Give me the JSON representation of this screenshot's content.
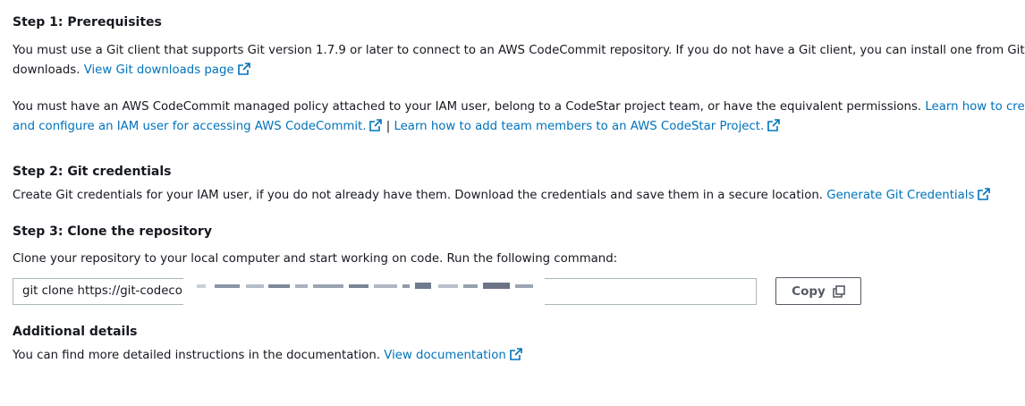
{
  "step1": {
    "title": "Step 1: Prerequisites",
    "p1_line1": "You must use a Git client that supports Git version 1.7.9 or later to connect to an AWS CodeCommit repository. If you do not have a Git client, you can install one from Git",
    "p1_line2": "downloads.",
    "p1_link": "View Git downloads page",
    "p2_line1": "You must have an AWS CodeCommit managed policy attached to your IAM user, belong to a CodeStar project team, or have the equivalent permissions.",
    "p2_link1_part1": "Learn how to create",
    "p2_link1_part2": "and configure an IAM user for accessing AWS CodeCommit.",
    "p2_sep": "|",
    "p2_link2": "Learn how to add team members to an AWS CodeStar Project."
  },
  "step2": {
    "title": "Step 2: Git credentials",
    "text": "Create Git credentials for your IAM user, if you do not already have them. Download the credentials and save them in a secure location.",
    "link": "Generate Git Credentials"
  },
  "step3": {
    "title": "Step 3: Clone the repository",
    "text": "Clone your repository to your local computer and start working on code. Run the following command:",
    "command": "git clone https://git-codecom",
    "copy_label": "Copy"
  },
  "additional": {
    "title": "Additional details",
    "text": "You can find more detailed instructions in the documentation.",
    "link": "View documentation"
  },
  "colors": {
    "link": "#0073bb",
    "text": "#16191f",
    "border": "#aab7b8"
  },
  "icons": {
    "external": "external-link-icon",
    "copy": "copy-icon"
  }
}
